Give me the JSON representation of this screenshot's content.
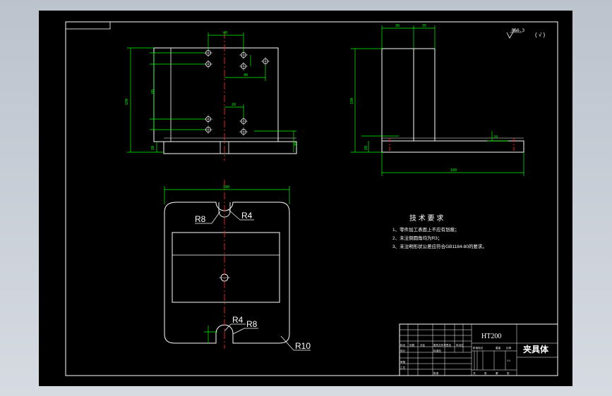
{
  "colors": {
    "background": "#000000",
    "lines": "#ffffff",
    "dimensions": "#00ff00",
    "centerline": "#ff0000",
    "frame": "#c4cad3"
  },
  "front_view": {
    "dims": {
      "top_width": "40",
      "left_height": "180",
      "mid_height": "60",
      "hole_offset_upper": "40",
      "hole_offset_lower": "20",
      "base_height": "20",
      "right_offset": "30"
    }
  },
  "side_view": {
    "dims": {
      "top_a": "30",
      "top_b": "35",
      "height": "180",
      "base_len": "180",
      "left_small": "20",
      "right_small": "20"
    }
  },
  "plan_view": {
    "dims": {
      "width": "180"
    },
    "radii": {
      "top_left": "R8",
      "top_right": "R4",
      "bottom_left": "R4",
      "bottom_right": "R8",
      "corner": "R10"
    }
  },
  "roughness": {
    "symbol": "Ra6.3",
    "check": "( √ )"
  },
  "tech_requirements": {
    "title": "技 术 要 求",
    "items": [
      "1、零件加工表面上不应有划痕；",
      "2、未注倒圆角均为R3；",
      "3、未注明形状公差应符合GB1184-80的要求。"
    ]
  },
  "title_block": {
    "material": "HT200",
    "part_name": "夹具体",
    "row_labels": [
      "标记",
      "处数",
      "分区",
      "更改文件号",
      "签名",
      "年月日"
    ],
    "role_labels": [
      "设计",
      "审核",
      "工艺"
    ],
    "sub_labels": [
      "标准化",
      "批准"
    ],
    "stage_labels": [
      "阶段标记",
      "重量",
      "比例"
    ],
    "scale": "1:1",
    "sheet_labels": [
      "共",
      "张",
      "第",
      "张"
    ]
  }
}
